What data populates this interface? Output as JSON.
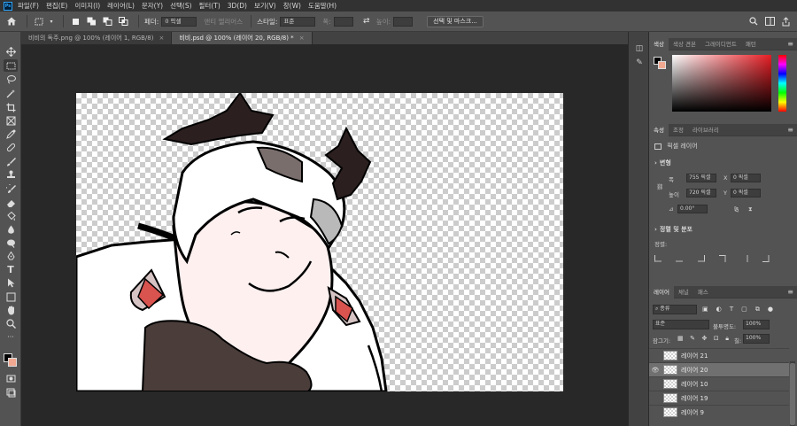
{
  "app": {
    "logo_text": "Ps",
    "menu": [
      "파일(F)",
      "편집(E)",
      "이미지(I)",
      "레이어(L)",
      "문자(Y)",
      "선택(S)",
      "필터(T)",
      "3D(D)",
      "보기(V)",
      "창(W)",
      "도움말(H)"
    ]
  },
  "options": {
    "feather_label": "페더:",
    "feather_value": "0 픽셀",
    "antialias_label": "앤티 앨리어스",
    "style_label": "스타일:",
    "style_value": "표준",
    "width_label": "폭:",
    "height_label": "높이:",
    "select_mask_button": "선택 및 마스크..."
  },
  "tabs": [
    {
      "label": "비비의 독주.png @ 100% (레이어 1, RGB/8)",
      "active": false
    },
    {
      "label": "비비.psd @ 100% (레이어 20, RGB/8) *",
      "active": true
    }
  ],
  "color_panel": {
    "tabs": [
      "색상",
      "색상 견본",
      "그레이디언트",
      "패턴"
    ],
    "fg_color": "#000000",
    "bg_color": "#f0a890",
    "hue_color": "#e51d24"
  },
  "properties_panel": {
    "tabs": [
      "속성",
      "조정",
      "라이브러리"
    ],
    "layer_type": "픽셀 레이어",
    "transform_label": "변형",
    "w_label": "폭",
    "w_value": "755 픽셀",
    "h_label": "높이",
    "h_value": "720 픽셀",
    "x_label": "X",
    "x_value": "0 픽셀",
    "y_label": "Y",
    "y_value": "0 픽셀",
    "angle_value": "0.00°",
    "align_label": "정렬 및 분포",
    "align_sub": "정렬:"
  },
  "layers_panel": {
    "tabs": [
      "레이어",
      "채널",
      "패스"
    ],
    "filter_label": "종류",
    "blend_mode": "표준",
    "opacity_label": "불투명도:",
    "opacity_value": "100%",
    "lock_label": "잠그기:",
    "fill_label": "칠:",
    "fill_value": "100%",
    "layers": [
      {
        "name": "레이어 21",
        "visible": false,
        "selected": false
      },
      {
        "name": "레이어 20",
        "visible": true,
        "selected": true
      },
      {
        "name": "레이어 10",
        "visible": false,
        "selected": false
      },
      {
        "name": "레이어 19",
        "visible": false,
        "selected": false
      },
      {
        "name": "레이어 9",
        "visible": false,
        "selected": false
      }
    ]
  }
}
